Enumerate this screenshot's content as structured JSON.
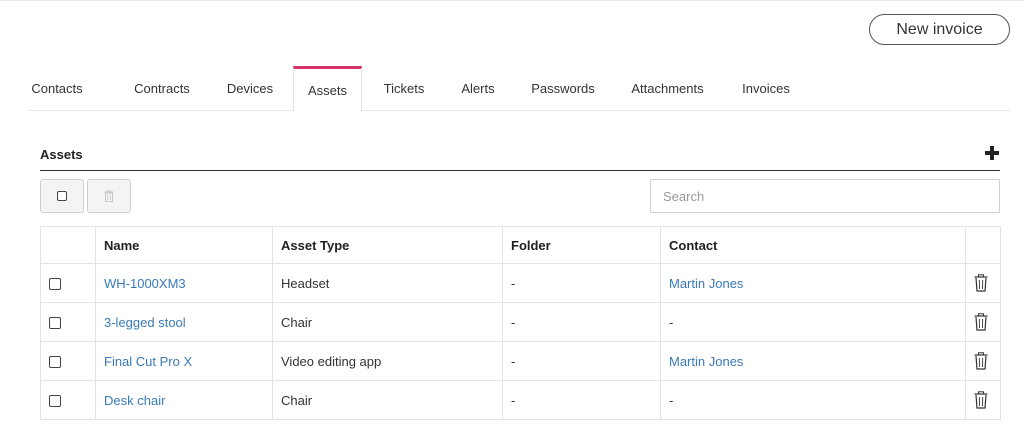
{
  "header": {
    "new_invoice_label": "New invoice"
  },
  "tabs": [
    {
      "label": "Contacts"
    },
    {
      "label": "Contracts"
    },
    {
      "label": "Devices"
    },
    {
      "label": "Assets",
      "active": true
    },
    {
      "label": "Tickets"
    },
    {
      "label": "Alerts"
    },
    {
      "label": "Passwords"
    },
    {
      "label": "Attachments"
    },
    {
      "label": "Invoices"
    }
  ],
  "section": {
    "title": "Assets",
    "add_icon": "plus-icon",
    "search_placeholder": "Search",
    "search_value": ""
  },
  "table": {
    "columns": [
      "Name",
      "Asset Type",
      "Folder",
      "Contact"
    ],
    "rows": [
      {
        "name": "WH-1000XM3",
        "type": "Headset",
        "folder": "-",
        "contact": "Martin Jones"
      },
      {
        "name": "3-legged stool",
        "type": "Chair",
        "folder": "-",
        "contact": "-"
      },
      {
        "name": "Final Cut Pro X",
        "type": "Video editing app",
        "folder": "-",
        "contact": "Martin Jones"
      },
      {
        "name": "Desk chair",
        "type": "Chair",
        "folder": "-",
        "contact": "-"
      }
    ]
  },
  "colors": {
    "accent": "#d6336c",
    "link": "#3a7ab8"
  }
}
